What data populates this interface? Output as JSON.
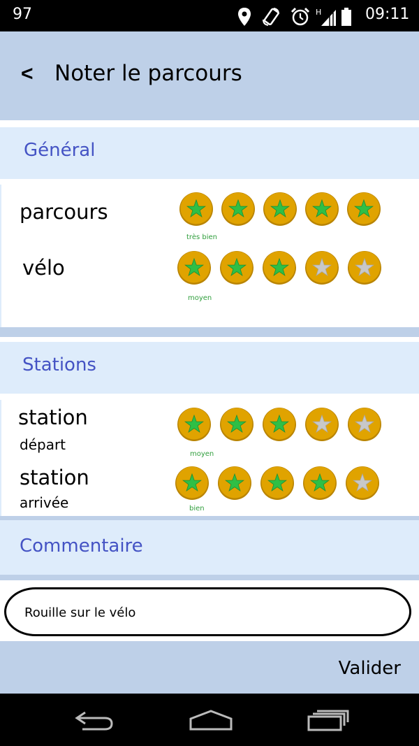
{
  "status_bar": {
    "battery_level": "97",
    "time": "09:11",
    "icons": [
      "location-icon",
      "rotate-icon",
      "alarm-icon",
      "signal-icon",
      "battery-icon"
    ]
  },
  "header": {
    "back_label": "<",
    "title": "Noter le parcours"
  },
  "sections": {
    "general": {
      "title": "Général",
      "rows": [
        {
          "label": "parcours",
          "rating": 5,
          "max": 5,
          "rating_text": "très bien"
        },
        {
          "label": "vélo",
          "rating": 3,
          "max": 5,
          "rating_text": "moyen"
        }
      ]
    },
    "stations": {
      "title": "Stations",
      "rows": [
        {
          "label": "station",
          "sublabel": "départ",
          "rating": 3,
          "max": 5,
          "rating_text": "moyen"
        },
        {
          "label": "station",
          "sublabel": "arrivée",
          "rating": 4,
          "max": 5,
          "rating_text": "bien"
        }
      ]
    },
    "comment": {
      "title": "Commentaire",
      "value": "Rouille sur le vélo"
    }
  },
  "footer": {
    "validate_label": "Valider"
  },
  "colors": {
    "header_bg": "#bed0e8",
    "section_bg": "#deecfb",
    "section_text": "#4453c4",
    "star_badge": "#e0a300",
    "star_on": "#2fbf46",
    "star_off": "#c8c8c8",
    "rating_text": "#2f9e3c"
  }
}
